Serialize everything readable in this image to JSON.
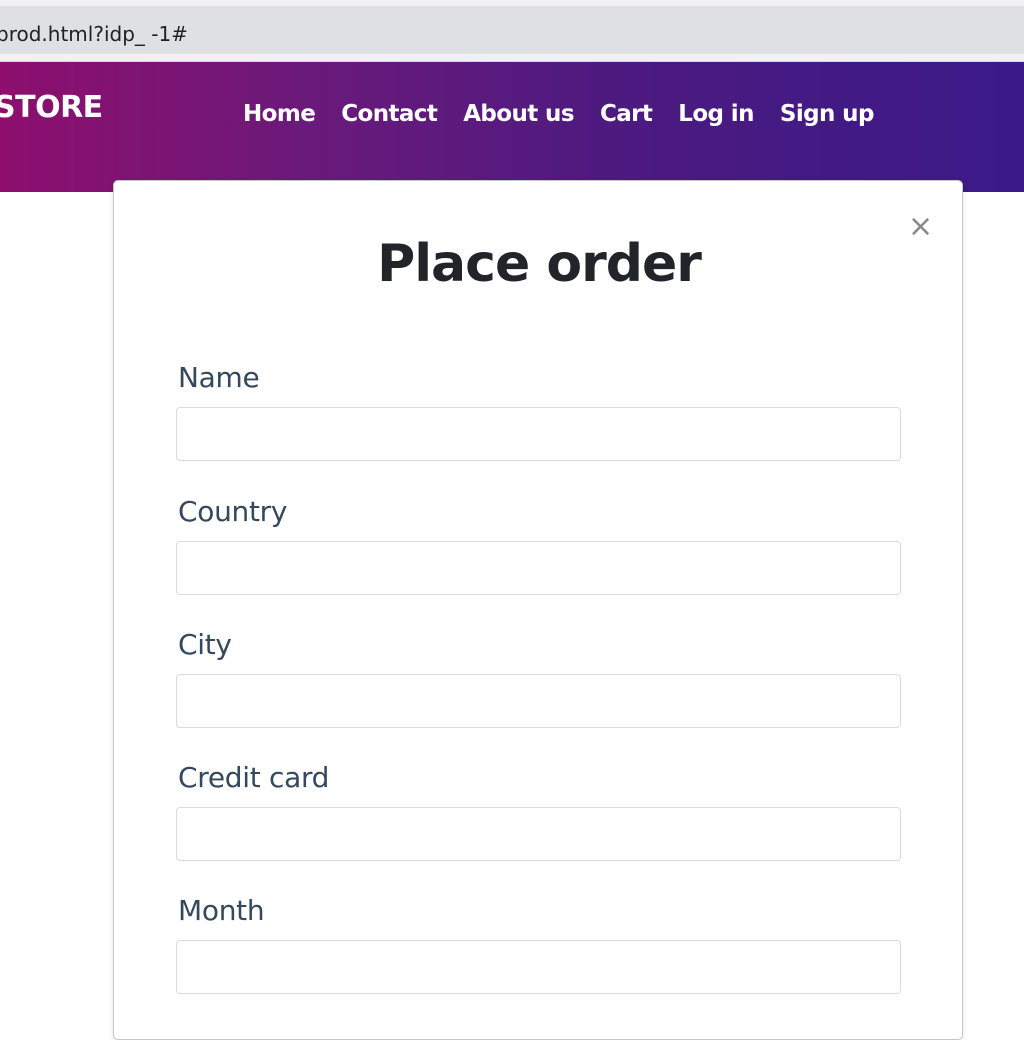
{
  "browser": {
    "url": "prod.html?idp_ -1#"
  },
  "navbar": {
    "brand": "STORE",
    "links": [
      "Home",
      "Contact",
      "About us",
      "Cart",
      "Log in",
      "Sign up"
    ]
  },
  "modal": {
    "title": "Place order",
    "close_icon": "×",
    "fields": [
      {
        "label": "Name",
        "value": "",
        "placeholder": ""
      },
      {
        "label": "Country",
        "value": "",
        "placeholder": ""
      },
      {
        "label": "City",
        "value": "",
        "placeholder": ""
      },
      {
        "label": "Credit card",
        "value": "",
        "placeholder": ""
      },
      {
        "label": "Month",
        "value": "",
        "placeholder": ""
      }
    ]
  },
  "colors": {
    "navbar_gradient_start": "#8e0f6e",
    "navbar_gradient_end": "#3a1a88",
    "title_text": "#212529",
    "label_text": "#34495e"
  }
}
